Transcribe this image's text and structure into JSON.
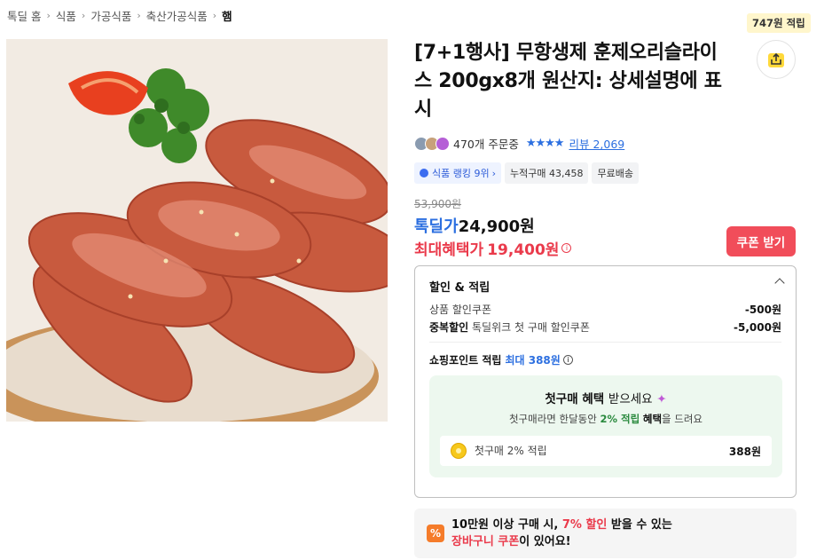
{
  "breadcrumb": {
    "items": [
      "톡딜 홈",
      "식품",
      "가공식품",
      "축산가공식품",
      "햄"
    ]
  },
  "product": {
    "title": "[7+1행사] 무항생제 훈제오리슬라이스 200gx8개 원산지: 상세설명에 표시",
    "point_tag": "747원 적립",
    "share_icon": "share-icon",
    "order_count": "470개 주문중",
    "rating_stars": "★★★★",
    "review_text": "리뷰 2,069"
  },
  "badges": {
    "rank": "식품 랭킹 9위",
    "cumulative": "누적구매 43,458",
    "shipping": "무료배송"
  },
  "price": {
    "original": "53,900원",
    "deal_label": "톡딜가",
    "deal_price": "24,900원",
    "max_label": "최대혜택가",
    "max_price": "19,400원",
    "coupon_button": "쿠폰 받기"
  },
  "discount": {
    "title": "할인 & 적립",
    "product_coupon_label": "상품 할인쿠폰",
    "product_coupon_amount": "-500원",
    "dup_label_bold": "중복할인",
    "dup_label": "톡딜위크 첫 구매 할인쿠폰",
    "dup_amount": "-5,000원",
    "shop_point_label": "쇼핑포인트 적립",
    "shop_point_max": "최대 388원"
  },
  "first_buy": {
    "title_bold": "첫구매 혜택",
    "title_light": "받으세요",
    "sub_prefix": "첫구매라면 한달동안",
    "sub_rate": "2% 적립",
    "sub_strong": "혜택",
    "sub_suffix": "을 드려요",
    "card_label": "첫구매 2% 적립",
    "card_amount": "388원"
  },
  "cart_banner": {
    "line1_prefix": "10만원 이상 구매 시,",
    "line1_red": "7% 할인",
    "line1_suffix": "받을 수 있는",
    "line2_red": "장바구니 쿠폰",
    "line2_suffix": "이 있어요!"
  },
  "colors": {
    "accent_blue": "#2c6fe0",
    "accent_red": "#ea3a4b",
    "coupon_button": "#f14d5a",
    "first_buy_bg": "#edf8ef"
  }
}
